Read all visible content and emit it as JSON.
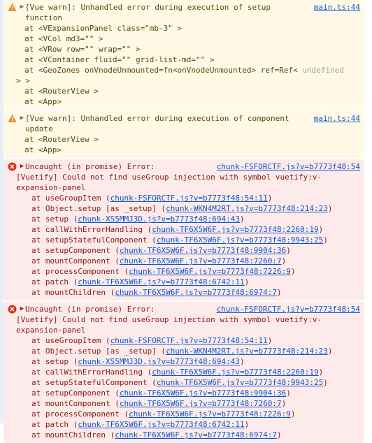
{
  "console": {
    "colors": {
      "warn_background": "#fff9e5",
      "warn_text": "#5c4813",
      "error_background": "#fcebea",
      "error_text": "#8b1a10",
      "link": "#1155cc",
      "warn_icon": "#e8892a",
      "error_icon": "#d93025",
      "dim_text": "#a3a3a3",
      "gutter": "#e8eef5"
    },
    "expand_arrow": "▶",
    "messages": [
      {
        "type": "warning",
        "icon": "warning-triangle-icon",
        "head": "[Vue warn]: Unhandled error during execution of setup function",
        "source": "main.ts:44",
        "component_trace": [
          "at <VExpansionPanel class=\"mb-3\" >",
          "at <VCol md3=\"\" >",
          "at <VRow row=\"\" wrap=\"\" >",
          "at <VContainer fluid=\"\" grid-list-md=\"\" >",
          "at <GeoZones onVnodeUnmounted=fn<onVnodeUnmounted> ref=Ref< ",
          "at <RouterView >",
          "at <App>"
        ],
        "trace_dim_token": "undefined",
        "trace_tail": "> >"
      },
      {
        "type": "warning",
        "icon": "warning-triangle-icon",
        "head": "[Vue warn]: Unhandled error during execution of component update",
        "source": "main.ts:44",
        "component_trace": [
          "at <RouterView >",
          "at <App>"
        ]
      },
      {
        "type": "error",
        "icon": "error-circle-icon",
        "head": "Uncaught (in promise) Error:",
        "source": "chunk-FSFORCTF.js?v=b7773f48:54",
        "message": "[Vuetify] Could not find useGroup injection with symbol vuetify:v-expansion-panel",
        "stack": [
          {
            "fn": "at useGroupItem (",
            "loc": "chunk-FSFORCTF.js?v=b7773f48:54:11",
            "end": ")"
          },
          {
            "fn": "at Object.setup [as _setup] (",
            "loc": "chunk-WKN4M2RT.js?v=b7773f48:214:23",
            "end": ")"
          },
          {
            "fn": "at setup (",
            "loc": "chunk-XS5MMJ3D.js?v=b7773f48:694:43",
            "end": ")"
          },
          {
            "fn": "at callWithErrorHandling (",
            "loc": "chunk-TF6X5W6F.js?v=b7773f48:2260:19",
            "end": ")"
          },
          {
            "fn": "at setupStatefulComponent (",
            "loc": "chunk-TF6X5W6F.js?v=b7773f48:9943:25",
            "end": ")"
          },
          {
            "fn": "at setupComponent (",
            "loc": "chunk-TF6X5W6F.js?v=b7773f48:9904:36",
            "end": ")"
          },
          {
            "fn": "at mountComponent (",
            "loc": "chunk-TF6X5W6F.js?v=b7773f48:7260:7",
            "end": ")"
          },
          {
            "fn": "at processComponent (",
            "loc": "chunk-TF6X5W6F.js?v=b7773f48:7226:9",
            "end": ")"
          },
          {
            "fn": "at patch (",
            "loc": "chunk-TF6X5W6F.js?v=b7773f48:6742:11",
            "end": ")"
          },
          {
            "fn": "at mountChildren (",
            "loc": "chunk-TF6X5W6F.js?v=b7773f48:6974:7",
            "end": ")"
          }
        ]
      },
      {
        "type": "error",
        "icon": "error-circle-icon",
        "head": "Uncaught (in promise) Error:",
        "source": "chunk-FSFORCTF.js?v=b7773f48:54",
        "message": "[Vuetify] Could not find useGroup injection with symbol vuetify:v-expansion-panel",
        "stack": [
          {
            "fn": "at useGroupItem (",
            "loc": "chunk-FSFORCTF.js?v=b7773f48:54:11",
            "end": ")"
          },
          {
            "fn": "at Object.setup [as _setup] (",
            "loc": "chunk-WKN4M2RT.js?v=b7773f48:214:23",
            "end": ")"
          },
          {
            "fn": "at setup (",
            "loc": "chunk-XS5MMJ3D.js?v=b7773f48:694:43",
            "end": ")"
          },
          {
            "fn": "at callWithErrorHandling (",
            "loc": "chunk-TF6X5W6F.js?v=b7773f48:2260:19",
            "end": ")"
          },
          {
            "fn": "at setupStatefulComponent (",
            "loc": "chunk-TF6X5W6F.js?v=b7773f48:9943:25",
            "end": ")"
          },
          {
            "fn": "at setupComponent (",
            "loc": "chunk-TF6X5W6F.js?v=b7773f48:9904:36",
            "end": ")"
          },
          {
            "fn": "at mountComponent (",
            "loc": "chunk-TF6X5W6F.js?v=b7773f48:7260:7",
            "end": ")"
          },
          {
            "fn": "at processComponent (",
            "loc": "chunk-TF6X5W6F.js?v=b7773f48:7226:9",
            "end": ")"
          },
          {
            "fn": "at patch (",
            "loc": "chunk-TF6X5W6F.js?v=b7773f48:6742:11",
            "end": ")"
          },
          {
            "fn": "at mountChildren (",
            "loc": "chunk-TF6X5W6F.js?v=b7773f48:6974:7",
            "end": ")"
          }
        ]
      }
    ]
  }
}
